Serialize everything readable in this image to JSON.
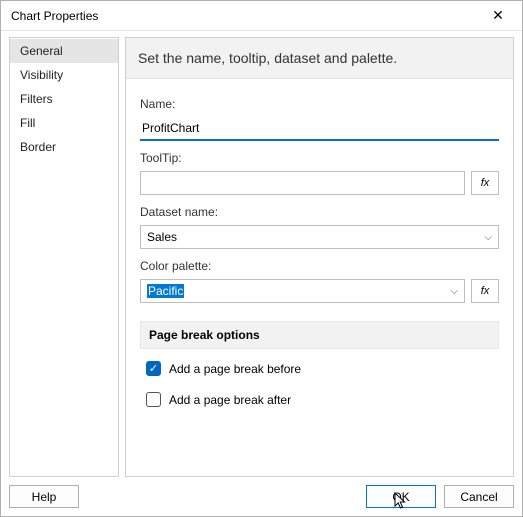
{
  "window": {
    "title": "Chart Properties"
  },
  "sidebar": {
    "items": [
      {
        "label": "General",
        "selected": true
      },
      {
        "label": "Visibility",
        "selected": false
      },
      {
        "label": "Filters",
        "selected": false
      },
      {
        "label": "Fill",
        "selected": false
      },
      {
        "label": "Border",
        "selected": false
      }
    ]
  },
  "header": {
    "text": "Set the name, tooltip, dataset and palette."
  },
  "fields": {
    "name": {
      "label": "Name:",
      "value": "ProfitChart"
    },
    "tooltip": {
      "label": "ToolTip:",
      "value": "",
      "fx": "fx"
    },
    "dataset": {
      "label": "Dataset name:",
      "value": "Sales"
    },
    "palette": {
      "label": "Color palette:",
      "value": "Pacific",
      "fx": "fx"
    }
  },
  "pageBreak": {
    "header": "Page break options",
    "before": {
      "label": "Add a page break before",
      "checked": true
    },
    "after": {
      "label": "Add a page break after",
      "checked": false
    }
  },
  "footer": {
    "help": "Help",
    "ok": "OK",
    "cancel": "Cancel"
  }
}
